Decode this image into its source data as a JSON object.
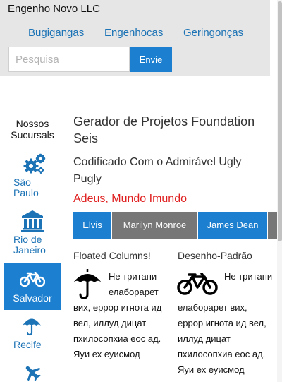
{
  "header": {
    "brand": "Engenho Novo LLC",
    "nav": [
      "Bugigangas",
      "Engenhocas",
      "Geringonças"
    ],
    "search_placeholder": "Pesquisa",
    "search_button": "Envie"
  },
  "sidebar": {
    "title": "Nossos Sucursals",
    "items": [
      {
        "label": "São Paulo",
        "icon": "gears-icon",
        "active": false
      },
      {
        "label": "Rio de Janeiro",
        "icon": "bank-icon",
        "active": false
      },
      {
        "label": "Salvador",
        "icon": "bicycle-icon",
        "active": true
      },
      {
        "label": "Recife",
        "icon": "umbrella-icon",
        "active": false
      },
      {
        "label": "",
        "icon": "airplane-icon",
        "active": false
      }
    ]
  },
  "main": {
    "title": "Gerador de Projetos Foundation Seis",
    "subtitle": "Codificado Com o Admirável Ugly Pugly",
    "alert": "Adeus, Mundo Imundo",
    "tabs": [
      "Elvis",
      "Marilyn Monroe",
      "James Dean"
    ],
    "columns": [
      {
        "title": "Floated Columns!",
        "icon": "umbrella-icon",
        "text": "Не тритани елаборарет вих, еррор игнота ид вел, иллуд дицат пхилосопхиа еос ад. Яуи ех еуисмод"
      },
      {
        "title": "Desenho-Padrão",
        "icon": "bicycle-icon",
        "text": "Не тритани елаборарет вих, еррор игнота ид вел, иллуд дицат пхилосопхиа еос ад. Яуи ех еуисмод"
      }
    ]
  },
  "colors": {
    "accent": "#1c7fcf",
    "link": "#1c73b5",
    "alert": "#e02020",
    "tab_inactive": "#777777",
    "header_bg": "#e6e6e6"
  }
}
